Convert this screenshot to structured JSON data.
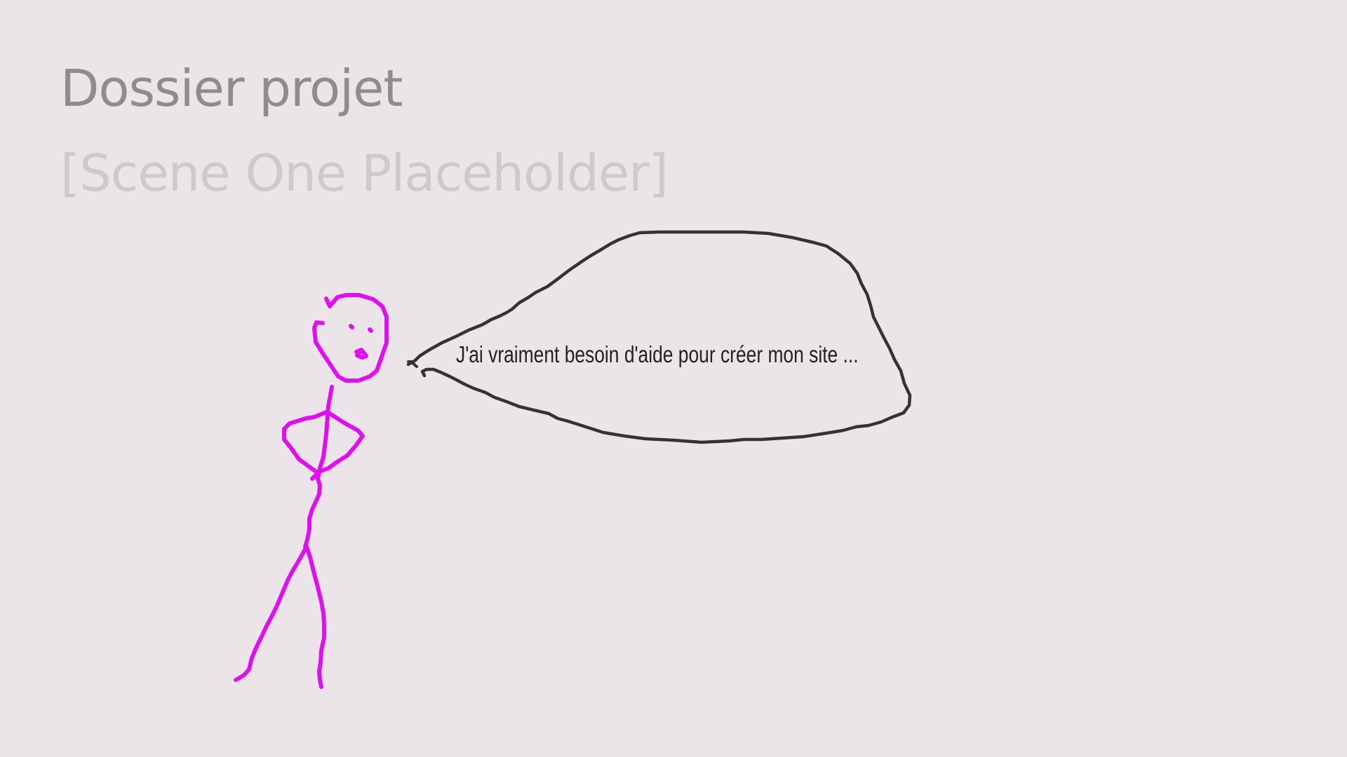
{
  "slide": {
    "title": "Dossier projet",
    "subtitle": "[Scene One Placeholder]",
    "speech_text": "J'ai vraiment besoin d'aide pour créer mon site ..."
  },
  "colors": {
    "background": "#ebe5ea",
    "title": "#8f8c90",
    "subtitle": "#cdc9cd",
    "stick_figure": "#e010ee",
    "speech_bubble": "#333333"
  }
}
